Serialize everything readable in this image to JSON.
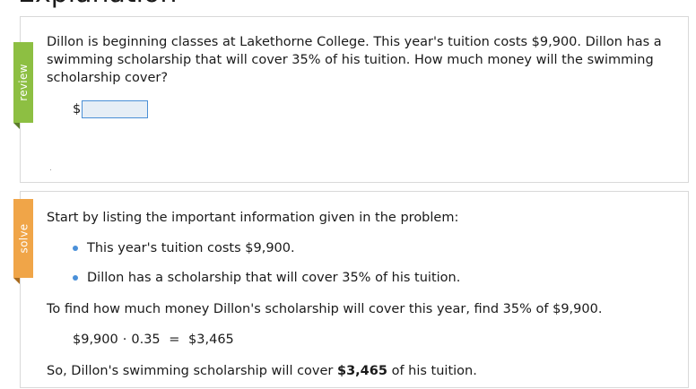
{
  "page": {
    "heading": "Explanation"
  },
  "review": {
    "tab_label": "review",
    "question": "Dillon is beginning classes at Lakethorne College. This year's tuition costs $9,900. Dillon has a swimming scholarship that will cover 35% of his tuition. How much money will the swimming scholarship cover?",
    "answer": {
      "prefix": "$",
      "value": ""
    }
  },
  "solve": {
    "tab_label": "solve",
    "intro": "Start by listing the important information given in the problem:",
    "bullets": [
      "This year's tuition costs $9,900.",
      "Dillon has a scholarship that will cover 35% of his tuition."
    ],
    "find": "To find how much money Dillon's scholarship will cover this year, find 35% of $9,900.",
    "calc": {
      "left": "$9,900",
      "dot": "·",
      "right": "0.35",
      "equals": "=",
      "result": "$3,465"
    },
    "conclusion": {
      "before": "So, Dillon's swimming scholarship will cover ",
      "amount": "$3,465",
      "after": " of his tuition."
    }
  },
  "colors": {
    "review_tab": "#8dbf42",
    "solve_tab": "#f0a548",
    "bullet": "#4a90d9",
    "input_border": "#4a8fd6"
  }
}
